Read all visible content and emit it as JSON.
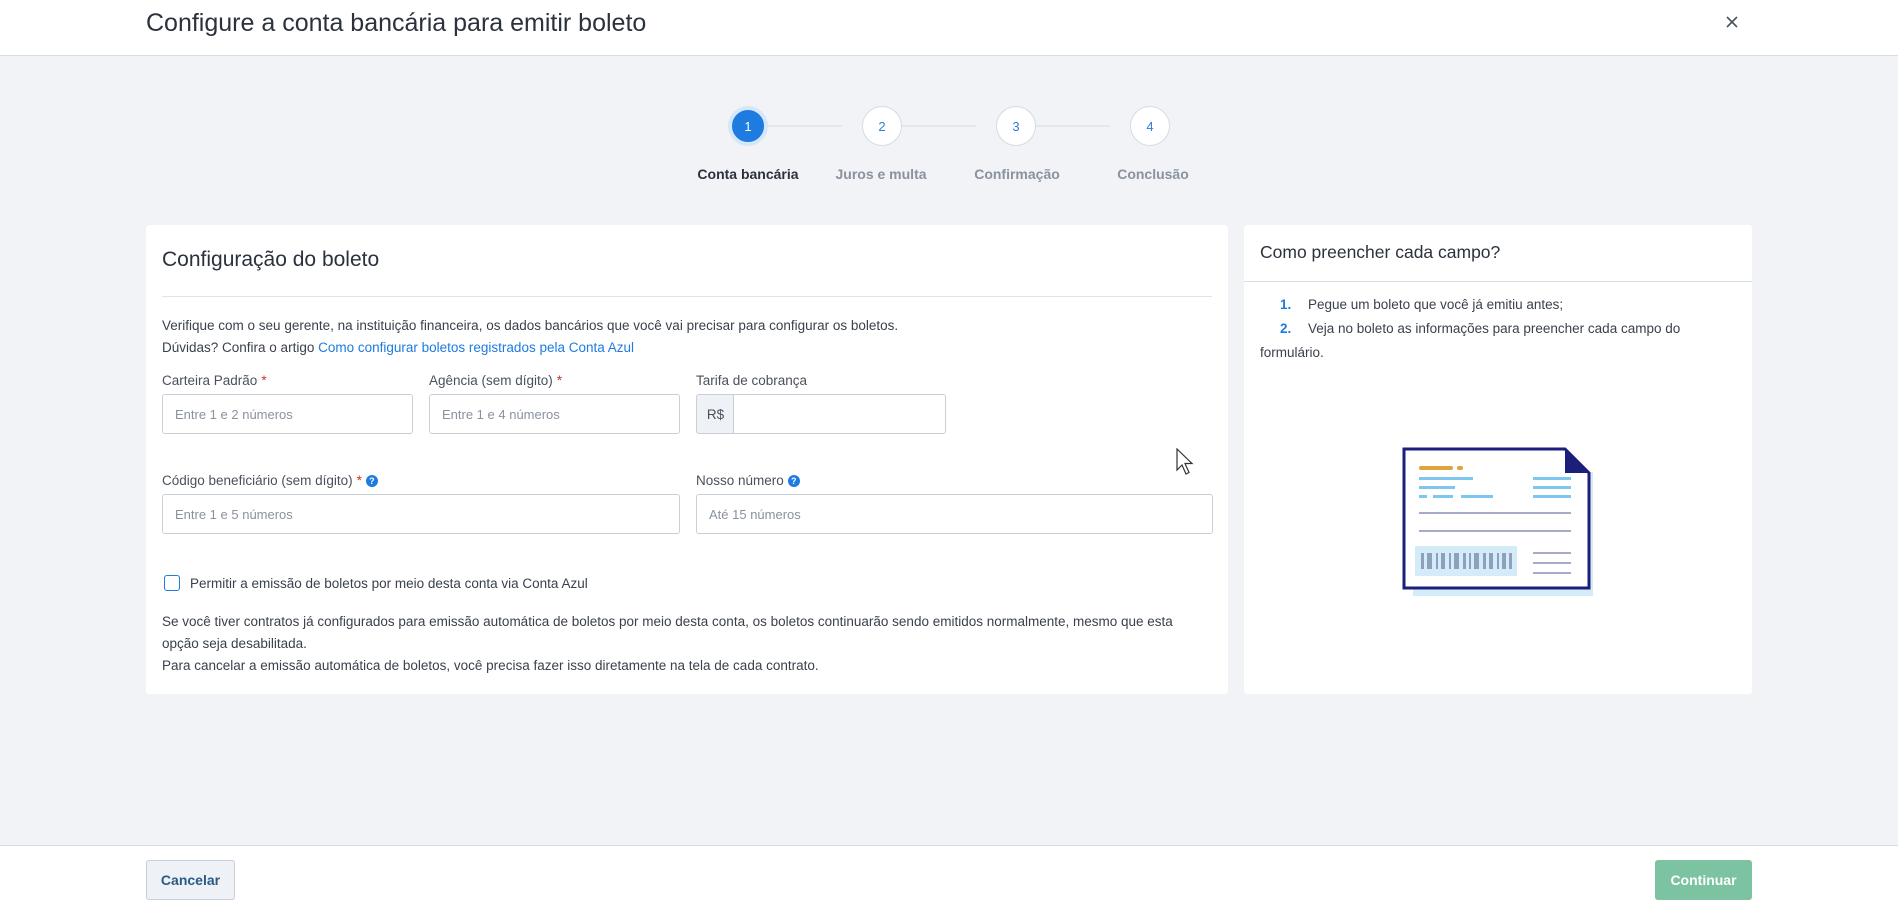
{
  "header": {
    "title": "Configure a conta bancária para emitir boleto",
    "close_icon": "close-icon"
  },
  "stepper": {
    "steps": [
      {
        "number": "1",
        "label": "Conta bancária",
        "active": true
      },
      {
        "number": "2",
        "label": "Juros e multa",
        "active": false
      },
      {
        "number": "3",
        "label": "Confirmação",
        "active": false
      },
      {
        "number": "4",
        "label": "Conclusão",
        "active": false
      }
    ]
  },
  "form": {
    "title": "Configuração do boleto",
    "intro_line1": "Verifique com o seu gerente, na instituição financeira, os dados bancários que você vai precisar para configurar os boletos.",
    "intro_line2_prefix": "Dúvidas? Confira o artigo ",
    "intro_link": "Como configurar boletos registrados pela Conta Azul",
    "carteira": {
      "label": "Carteira Padrão",
      "required_mark": "*",
      "placeholder": "Entre 1 e 2 números",
      "value": ""
    },
    "agencia": {
      "label": "Agência (sem dígito)",
      "required_mark": "*",
      "placeholder": "Entre 1 e 4 números",
      "value": ""
    },
    "tarifa": {
      "label": "Tarifa de cobrança",
      "prefix": "R$",
      "placeholder": "",
      "value": ""
    },
    "codigo": {
      "label": "Código beneficiário (sem dígito)",
      "required_mark": "*",
      "help_icon": "question-icon",
      "placeholder": "Entre 1 e 5 números",
      "value": ""
    },
    "nosso_numero": {
      "label": "Nosso número",
      "help_icon": "question-icon",
      "placeholder": "Até 15 números",
      "value": ""
    },
    "checkbox_label": "Permitir a emissão de boletos por meio desta conta via Conta Azul",
    "checkbox_checked": false,
    "note_line1": "Se você tiver contratos já configurados para emissão automática de boletos por meio desta conta, os boletos continuarão sendo emitidos normalmente, mesmo que esta opção seja desabilitada.",
    "note_line2": "Para cancelar a emissão automática de boletos, você precisa fazer isso diretamente na tela de cada contrato."
  },
  "help_panel": {
    "title": "Como preencher cada campo?",
    "items": [
      {
        "num": "1.",
        "text": "Pegue um boleto que você já emitiu antes;"
      },
      {
        "num": "2.",
        "text": "Veja no boleto as informações para preencher cada campo do formulário."
      }
    ],
    "illustration": "boleto-illustration"
  },
  "footer": {
    "cancel_label": "Cancelar",
    "continue_label": "Continuar"
  },
  "colors": {
    "accent": "#1e7be0",
    "continue_button": "#7cc3a2",
    "background": "#f1f3f7"
  }
}
